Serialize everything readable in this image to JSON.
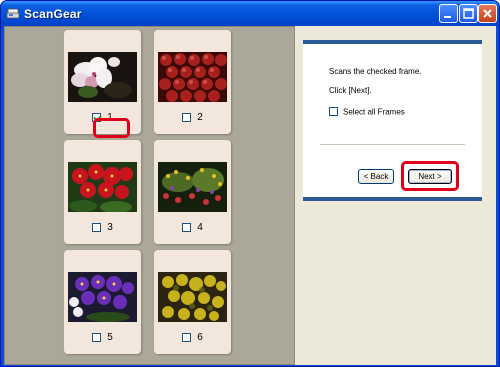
{
  "window": {
    "title": "ScanGear"
  },
  "titlebar_buttons": [
    "minimize-icon",
    "maximize-icon",
    "close-icon"
  ],
  "frames": [
    {
      "number": "1",
      "checked": true,
      "photo": "white orchid flowers"
    },
    {
      "number": "2",
      "checked": false,
      "photo": "red apples"
    },
    {
      "number": "3",
      "checked": false,
      "photo": "red flowers"
    },
    {
      "number": "4",
      "checked": false,
      "photo": "flower garden"
    },
    {
      "number": "5",
      "checked": false,
      "photo": "purple flowers"
    },
    {
      "number": "6",
      "checked": false,
      "photo": "yellow flowers"
    }
  ],
  "wizard": {
    "instruction": "Scans the checked frame.",
    "click_hint": "Click [Next].",
    "select_all_label": "Select all Frames",
    "back_label": "< Back",
    "next_label": "Next >"
  },
  "colors": {
    "highlight": "#e0001a",
    "panel_border": "#2b5a9a"
  }
}
